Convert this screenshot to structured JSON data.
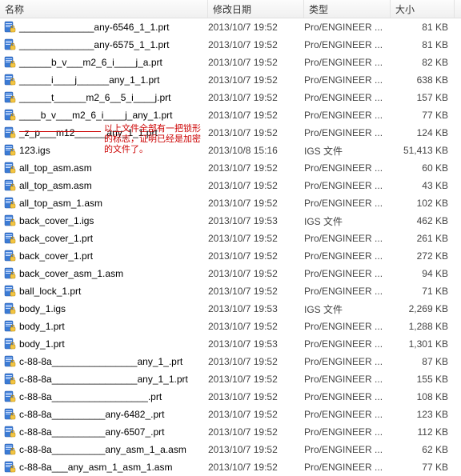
{
  "headers": {
    "name": "名称",
    "date": "修改日期",
    "type": "类型",
    "size": "大小"
  },
  "annotation": "以上文件全部有一把锁形的标志，证明已经是加密的文件了。",
  "files": [
    {
      "name": "______________any-6546_1_1.prt",
      "date": "2013/10/7 19:52",
      "type": "Pro/ENGINEER ...",
      "size": "81 KB"
    },
    {
      "name": "______________any-6575_1_1.prt",
      "date": "2013/10/7 19:52",
      "type": "Pro/ENGINEER ...",
      "size": "81 KB"
    },
    {
      "name": "______b_v___m2_6_i____j_a.prt",
      "date": "2013/10/7 19:52",
      "type": "Pro/ENGINEER ...",
      "size": "82 KB"
    },
    {
      "name": "______i____j______any_1_1.prt",
      "date": "2013/10/7 19:52",
      "type": "Pro/ENGINEER ...",
      "size": "638 KB"
    },
    {
      "name": "______t______m2_6__5_i____j.prt",
      "date": "2013/10/7 19:52",
      "type": "Pro/ENGINEER ...",
      "size": "157 KB"
    },
    {
      "name": "____b_v___m2_6_i____j_any_1.prt",
      "date": "2013/10/7 19:52",
      "type": "Pro/ENGINEER ...",
      "size": "77 KB"
    },
    {
      "name": "_z_p___m12______any_1_1.prt",
      "date": "2013/10/7 19:52",
      "type": "Pro/ENGINEER ...",
      "size": "124 KB"
    },
    {
      "name": "123.igs",
      "date": "2013/10/8 15:16",
      "type": "IGS 文件",
      "size": "51,413 KB"
    },
    {
      "name": "all_top_asm.asm",
      "date": "2013/10/7 19:52",
      "type": "Pro/ENGINEER ...",
      "size": "60 KB"
    },
    {
      "name": "all_top_asm.asm",
      "date": "2013/10/7 19:52",
      "type": "Pro/ENGINEER ...",
      "size": "43 KB"
    },
    {
      "name": "all_top_asm_1.asm",
      "date": "2013/10/7 19:52",
      "type": "Pro/ENGINEER ...",
      "size": "102 KB"
    },
    {
      "name": "back_cover_1.igs",
      "date": "2013/10/7 19:53",
      "type": "IGS 文件",
      "size": "462 KB"
    },
    {
      "name": "back_cover_1.prt",
      "date": "2013/10/7 19:52",
      "type": "Pro/ENGINEER ...",
      "size": "261 KB"
    },
    {
      "name": "back_cover_1.prt",
      "date": "2013/10/7 19:52",
      "type": "Pro/ENGINEER ...",
      "size": "272 KB"
    },
    {
      "name": "back_cover_asm_1.asm",
      "date": "2013/10/7 19:52",
      "type": "Pro/ENGINEER ...",
      "size": "94 KB"
    },
    {
      "name": "ball_lock_1.prt",
      "date": "2013/10/7 19:52",
      "type": "Pro/ENGINEER ...",
      "size": "71 KB"
    },
    {
      "name": "body_1.igs",
      "date": "2013/10/7 19:53",
      "type": "IGS 文件",
      "size": "2,269 KB"
    },
    {
      "name": "body_1.prt",
      "date": "2013/10/7 19:52",
      "type": "Pro/ENGINEER ...",
      "size": "1,288 KB"
    },
    {
      "name": "body_1.prt",
      "date": "2013/10/7 19:53",
      "type": "Pro/ENGINEER ...",
      "size": "1,301 KB"
    },
    {
      "name": "c-88-8a________________any_1_.prt",
      "date": "2013/10/7 19:52",
      "type": "Pro/ENGINEER ...",
      "size": "87 KB"
    },
    {
      "name": "c-88-8a________________any_1_1.prt",
      "date": "2013/10/7 19:52",
      "type": "Pro/ENGINEER ...",
      "size": "155 KB"
    },
    {
      "name": "c-88-8a__________________.prt",
      "date": "2013/10/7 19:52",
      "type": "Pro/ENGINEER ...",
      "size": "108 KB"
    },
    {
      "name": "c-88-8a__________any-6482_.prt",
      "date": "2013/10/7 19:52",
      "type": "Pro/ENGINEER ...",
      "size": "123 KB"
    },
    {
      "name": "c-88-8a__________any-6507_.prt",
      "date": "2013/10/7 19:52",
      "type": "Pro/ENGINEER ...",
      "size": "112 KB"
    },
    {
      "name": "c-88-8a__________any_asm_1_a.asm",
      "date": "2013/10/7 19:52",
      "type": "Pro/ENGINEER ...",
      "size": "62 KB"
    },
    {
      "name": "c-88-8a___any_asm_1_asm_1.asm",
      "date": "2013/10/7 19:52",
      "type": "Pro/ENGINEER ...",
      "size": "77 KB"
    }
  ]
}
